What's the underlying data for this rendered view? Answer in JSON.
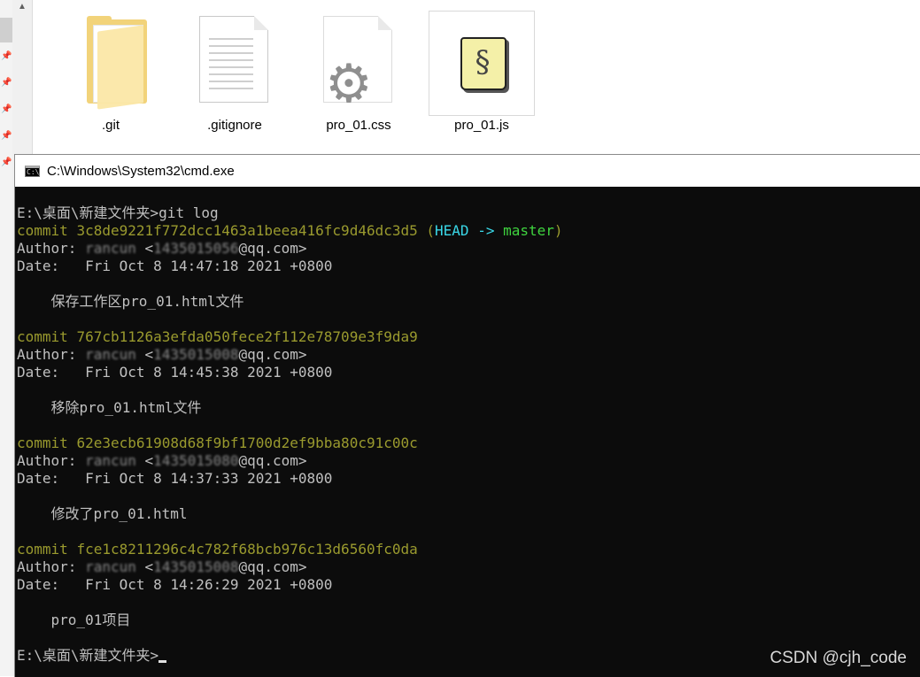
{
  "explorer": {
    "files": [
      {
        "name": ".git",
        "icon": "folder-icon"
      },
      {
        "name": ".gitignore",
        "icon": "document-icon"
      },
      {
        "name": "pro_01.css",
        "icon": "css-file-icon"
      },
      {
        "name": "pro_01.js",
        "icon": "js-script-icon"
      }
    ]
  },
  "cmd": {
    "title": "C:\\Windows\\System32\\cmd.exe",
    "prompt_path": "E:\\桌面\\新建文件夹>",
    "command": "git log",
    "commits": [
      {
        "label": "commit",
        "hash": "3c8de9221f772dcc1463a1beea416fc9d46dc3d5",
        "ref_open": "(",
        "head": "HEAD",
        "arrow": "->",
        "branch": "master",
        "ref_close": ")",
        "author_label": "Author:",
        "author_name": "rancun",
        "email_open": "<",
        "email_hidden": "1435015056",
        "email_domain": "@qq.com>",
        "date_label": "Date:",
        "date": "Fri Oct 8 14:47:18 2021 +0800",
        "message": "保存工作区pro_01.html文件"
      },
      {
        "label": "commit",
        "hash": "767cb1126a3efda050fece2f112e78709e3f9da9",
        "author_label": "Author:",
        "author_name": "rancun",
        "email_open": "<",
        "email_hidden": "1435015008",
        "email_domain": "@qq.com>",
        "date_label": "Date:",
        "date": "Fri Oct 8 14:45:38 2021 +0800",
        "message": "移除pro_01.html文件"
      },
      {
        "label": "commit",
        "hash": "62e3ecb61908d68f9bf1700d2ef9bba80c91c00c",
        "author_label": "Author:",
        "author_name": "rancun",
        "email_open": "<",
        "email_hidden": "1435015080",
        "email_domain": "@qq.com>",
        "date_label": "Date:",
        "date": "Fri Oct 8 14:37:33 2021 +0800",
        "message": "修改了pro_01.html"
      },
      {
        "label": "commit",
        "hash": "fce1c8211296c4c782f68bcb976c13d6560fc0da",
        "author_label": "Author:",
        "author_name": "rancun",
        "email_open": "<",
        "email_hidden": "1435015008",
        "email_domain": "@qq.com>",
        "date_label": "Date:",
        "date": "Fri Oct 8 14:26:29 2021 +0800",
        "message": "pro_01项目"
      }
    ]
  },
  "watermark": "CSDN @cjh_code",
  "colors": {
    "console_bg": "#0c0c0c",
    "console_text": "#c0c0c0",
    "commit_yellow": "#9a9a2e",
    "head_cyan": "#3ad8e8",
    "branch_green": "#3fd33f"
  }
}
